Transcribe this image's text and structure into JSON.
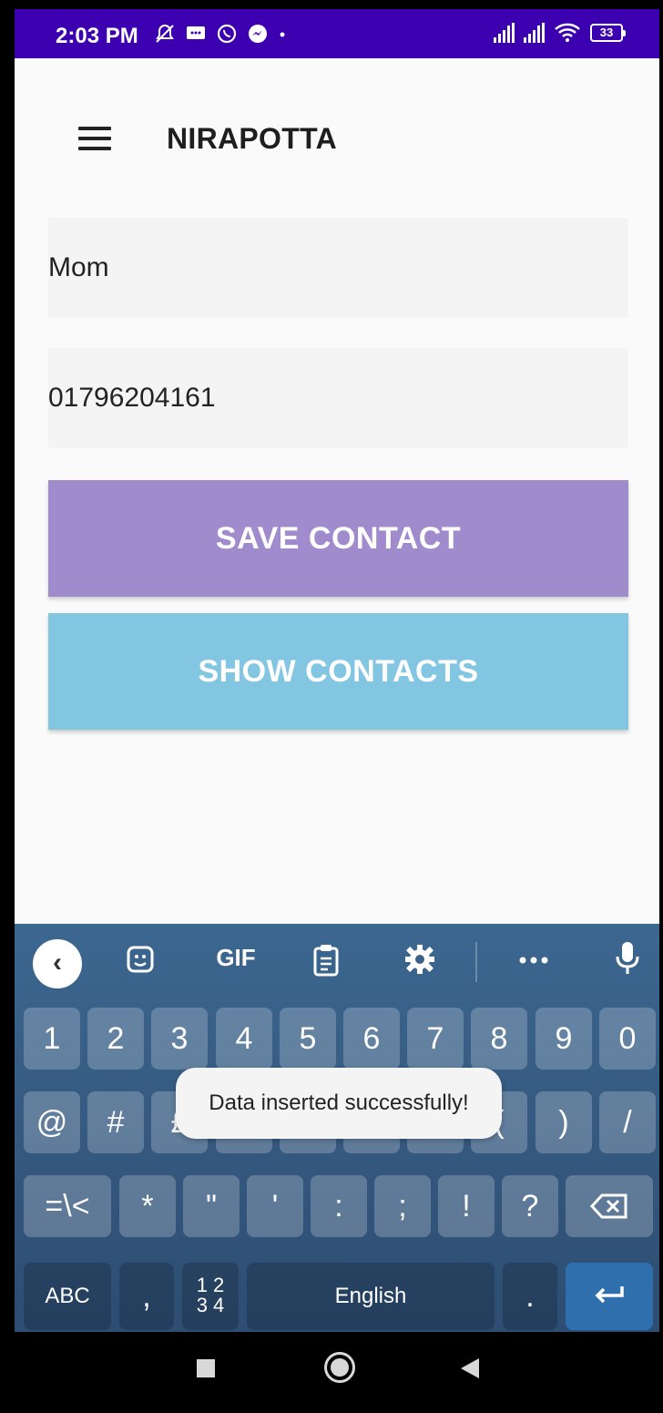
{
  "status_bar": {
    "time": "2:03 PM",
    "battery": "33"
  },
  "app": {
    "title": "NIRAPOTTA",
    "name_field_value": "Mom",
    "phone_field_value": "01796204161",
    "save_button": "SAVE CONTACT",
    "show_button": "SHOW CONTACTS",
    "colors": {
      "status_bar": "#3c00b0",
      "save_button": "#a08bcc",
      "show_button": "#82c6e2",
      "enter_key": "#2f6fae"
    }
  },
  "keyboard": {
    "toolbar": {
      "gif": "GIF",
      "icons": [
        "back-icon",
        "sticker-icon",
        "clipboard-icon",
        "settings-icon",
        "more-icon",
        "microphone-icon"
      ]
    },
    "row1": [
      "1",
      "2",
      "3",
      "4",
      "5",
      "6",
      "7",
      "8",
      "9",
      "0"
    ],
    "row2": [
      "@",
      "#",
      "£",
      "_",
      "&",
      "-",
      "+",
      "(",
      ")",
      "/"
    ],
    "row3": [
      "=\\<",
      "*",
      "\"",
      "'",
      ":",
      ";",
      "!",
      "?"
    ],
    "abc": "ABC",
    "comma": ",",
    "numpad_top": "1 2",
    "numpad_bottom": "3 4",
    "space": "English",
    "period": "."
  },
  "toast": {
    "message": "Data inserted successfully!"
  }
}
